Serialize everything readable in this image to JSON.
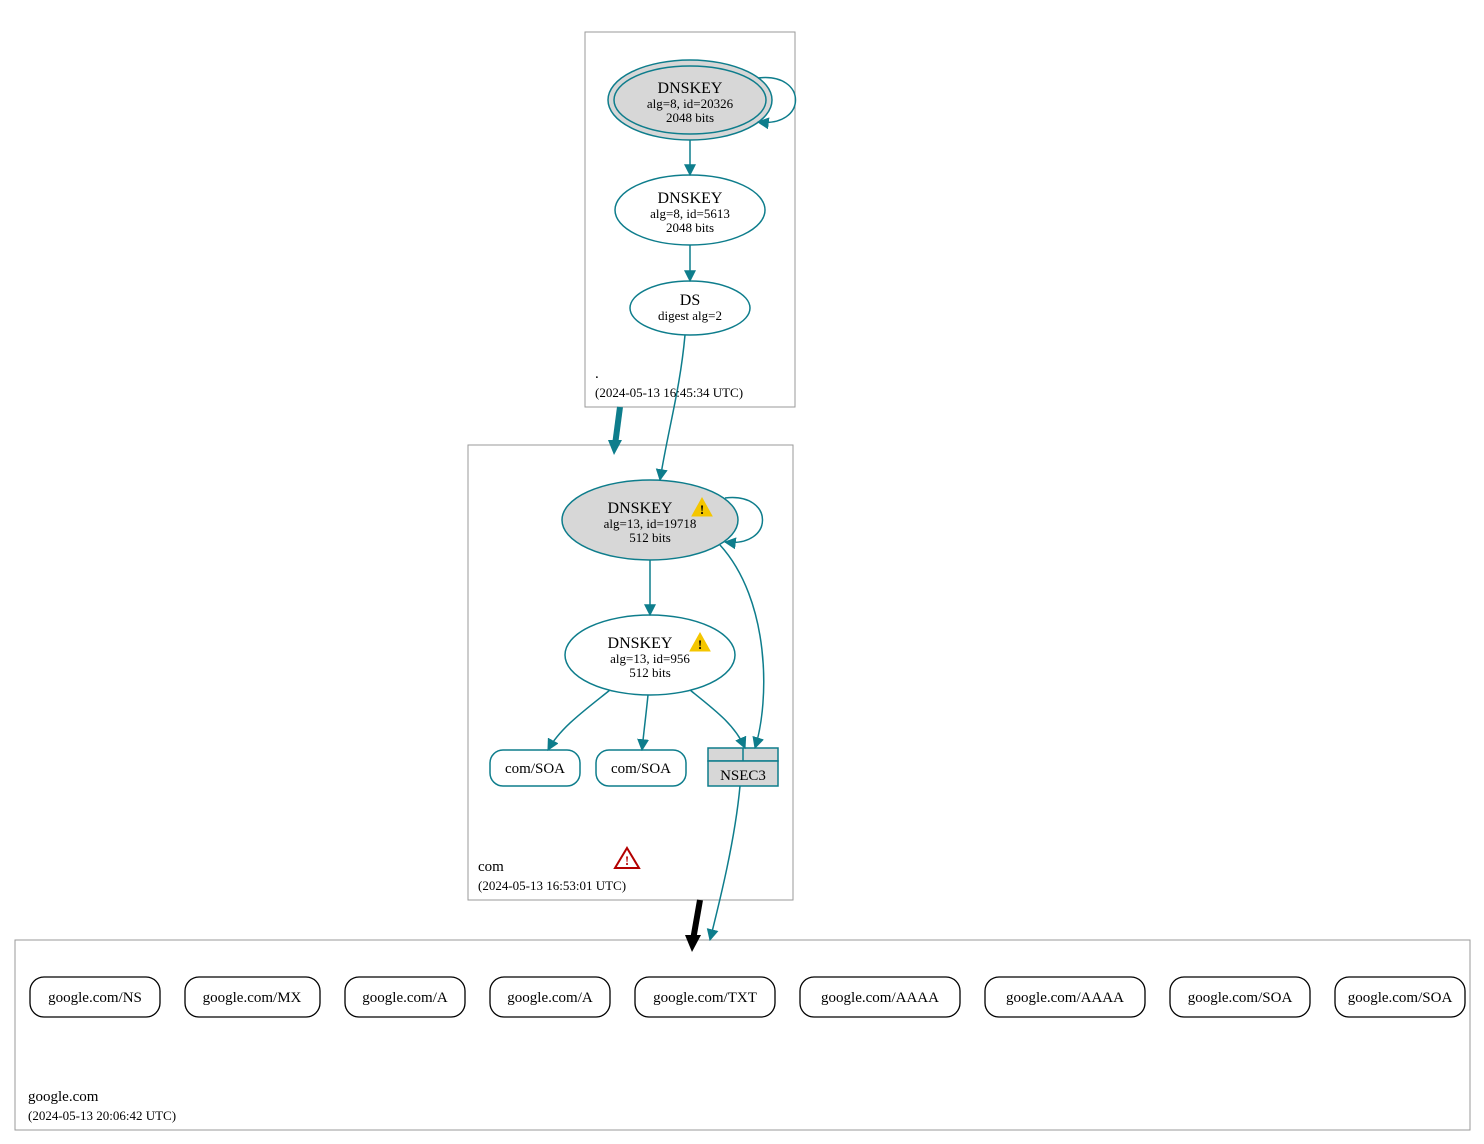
{
  "zones": {
    "root": {
      "name": ".",
      "timestamp": "(2024-05-13 16:45:34 UTC)",
      "dnskey_ksk": {
        "title": "DNSKEY",
        "line2": "alg=8, id=20326",
        "line3": "2048 bits"
      },
      "dnskey_zsk": {
        "title": "DNSKEY",
        "line2": "alg=8, id=5613",
        "line3": "2048 bits"
      },
      "ds": {
        "title": "DS",
        "line2": "digest alg=2"
      }
    },
    "com": {
      "name": "com",
      "timestamp": "(2024-05-13 16:53:01 UTC)",
      "dnskey_ksk": {
        "title": "DNSKEY",
        "line2": "alg=13, id=19718",
        "line3": "512 bits"
      },
      "dnskey_zsk": {
        "title": "DNSKEY",
        "line2": "alg=13, id=956",
        "line3": "512 bits"
      },
      "soa1": "com/SOA",
      "soa2": "com/SOA",
      "nsec3": "NSEC3"
    },
    "google": {
      "name": "google.com",
      "timestamp": "(2024-05-13 20:06:42 UTC)",
      "records": [
        "google.com/NS",
        "google.com/MX",
        "google.com/A",
        "google.com/A",
        "google.com/TXT",
        "google.com/AAAA",
        "google.com/AAAA",
        "google.com/SOA",
        "google.com/SOA"
      ]
    }
  },
  "colors": {
    "teal": "#0e7d8c",
    "zoneBorder": "#9a9a9a",
    "nodeFill": "#d7d7d7",
    "black": "#000000"
  }
}
